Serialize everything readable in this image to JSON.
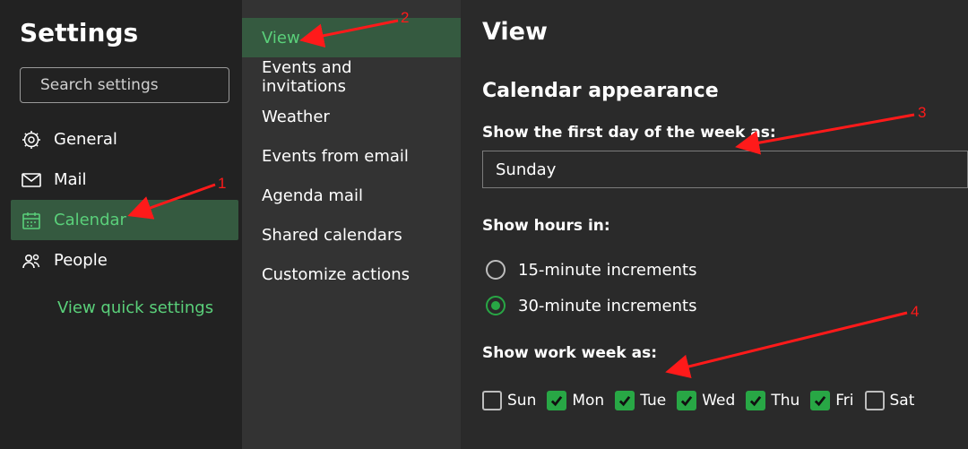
{
  "sidebar": {
    "title": "Settings",
    "search_placeholder": "Search settings",
    "items": [
      {
        "id": "general",
        "label": "General",
        "icon": "gear-icon",
        "selected": false
      },
      {
        "id": "mail",
        "label": "Mail",
        "icon": "mail-icon",
        "selected": false
      },
      {
        "id": "calendar",
        "label": "Calendar",
        "icon": "calendar-icon",
        "selected": true
      },
      {
        "id": "people",
        "label": "People",
        "icon": "people-icon",
        "selected": false
      }
    ],
    "quick_link": "View quick settings"
  },
  "submenu": {
    "items": [
      {
        "id": "view",
        "label": "View",
        "selected": true
      },
      {
        "id": "events-invites",
        "label": "Events and invitations",
        "selected": false
      },
      {
        "id": "weather",
        "label": "Weather",
        "selected": false
      },
      {
        "id": "events-from-email",
        "label": "Events from email",
        "selected": false
      },
      {
        "id": "agenda-mail",
        "label": "Agenda mail",
        "selected": false
      },
      {
        "id": "shared-calendars",
        "label": "Shared calendars",
        "selected": false
      },
      {
        "id": "customize-actions",
        "label": "Customize actions",
        "selected": false
      }
    ]
  },
  "main": {
    "title": "View",
    "section_title": "Calendar appearance",
    "first_day_label": "Show the first day of the week as:",
    "first_day_value": "Sunday",
    "show_hours_label": "Show hours in:",
    "hours_options": [
      {
        "id": "15min",
        "label": "15-minute increments",
        "selected": false
      },
      {
        "id": "30min",
        "label": "30-minute increments",
        "selected": true
      }
    ],
    "work_week_label": "Show work week as:",
    "days": [
      {
        "id": "sun",
        "label": "Sun",
        "checked": false
      },
      {
        "id": "mon",
        "label": "Mon",
        "checked": true
      },
      {
        "id": "tue",
        "label": "Tue",
        "checked": true
      },
      {
        "id": "wed",
        "label": "Wed",
        "checked": true
      },
      {
        "id": "thu",
        "label": "Thu",
        "checked": true
      },
      {
        "id": "fri",
        "label": "Fri",
        "checked": true
      },
      {
        "id": "sat",
        "label": "Sat",
        "checked": false
      }
    ]
  },
  "annotations": {
    "numbers": {
      "one": "1",
      "two": "2",
      "three": "3",
      "four": "4"
    },
    "arrow_color": "#ff1a1a"
  },
  "colors": {
    "accent": "#28a745",
    "accent_text": "#5ad07a",
    "selected_bg": "#355a40",
    "panel1": "#222222",
    "panel2": "#333333",
    "panel3": "#2a2a2a"
  }
}
